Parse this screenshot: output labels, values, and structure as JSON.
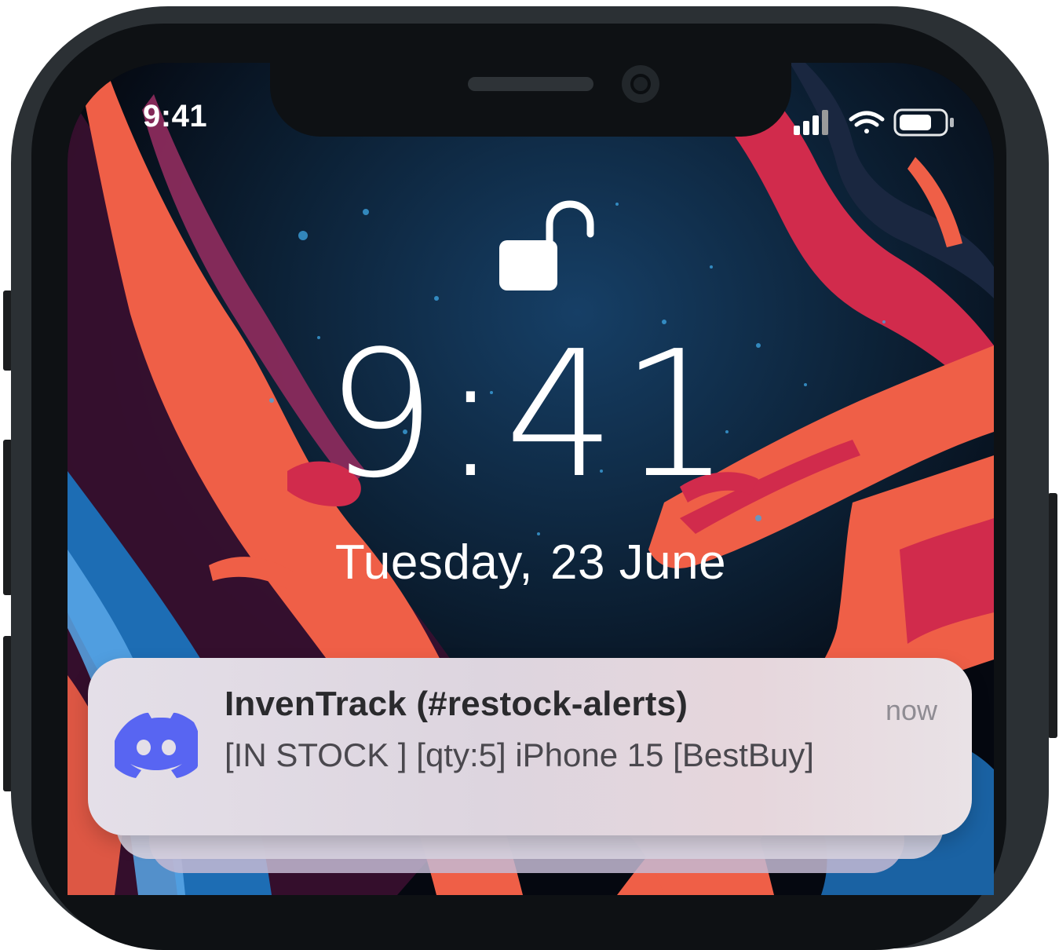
{
  "status_bar": {
    "time": "9:41",
    "icons": [
      "cellular-signal-icon",
      "wifi-icon",
      "battery-icon"
    ]
  },
  "lock_screen": {
    "lock_icon": "unlocked-padlock-icon",
    "time": "9:41",
    "date_day": "Tuesday,",
    "date_rest": "23 June"
  },
  "notification": {
    "app_icon": "discord-icon",
    "title": "InvenTrack (#restock-alerts)",
    "time": "now",
    "body": "[IN STOCK ] [qty:5] iPhone 15 [BestBuy]",
    "stacked_count_visible": 2
  },
  "colors": {
    "frame": "#2b3034",
    "discord_blurple": "#5865f2",
    "notification_bg": "#e4dfe8"
  }
}
